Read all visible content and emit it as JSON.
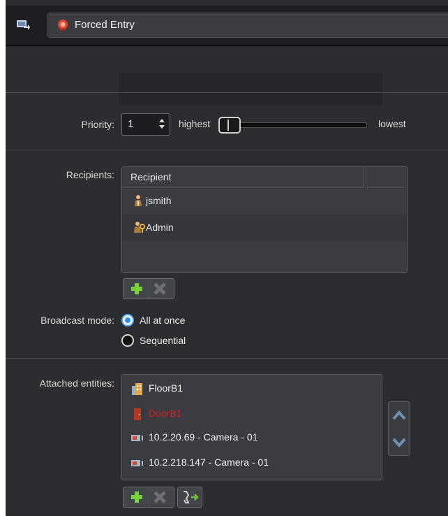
{
  "header": {
    "title": "Forced Entry",
    "icons": [
      "alarm-config-icon",
      "alarm-icon"
    ]
  },
  "priority": {
    "label": "Priority:",
    "value": "1",
    "min_label": "highest",
    "max_label": "lowest",
    "slider_level": 0.0
  },
  "recipients": {
    "label": "Recipients:",
    "column_header": "Recipient",
    "items": [
      {
        "name": "jsmith",
        "icon": "user-icon"
      },
      {
        "name": "Admin",
        "icon": "admin-user-icon"
      }
    ]
  },
  "broadcast": {
    "label": "Broadcast mode:",
    "options": [
      {
        "label": "All at once",
        "selected": true
      },
      {
        "label": "Sequential",
        "selected": false
      }
    ]
  },
  "attached": {
    "label": "Attached entities:",
    "items": [
      {
        "name": "FloorB1",
        "icon": "floor-icon",
        "color": "#f0f0f0"
      },
      {
        "name": "DoorB1",
        "icon": "door-icon",
        "color": "#cc2222"
      },
      {
        "name": "10.2.20.69 - Camera - 01",
        "icon": "camera-icon",
        "color": "#f0f0f0"
      },
      {
        "name": "10.2.218.147 - Camera - 01",
        "icon": "camera-icon",
        "color": "#f0f0f0"
      }
    ]
  },
  "colors": {
    "accent": "#2e8cff",
    "add": "#7bd13a",
    "remove": "#6d6f74",
    "offline": "#cc2222"
  }
}
